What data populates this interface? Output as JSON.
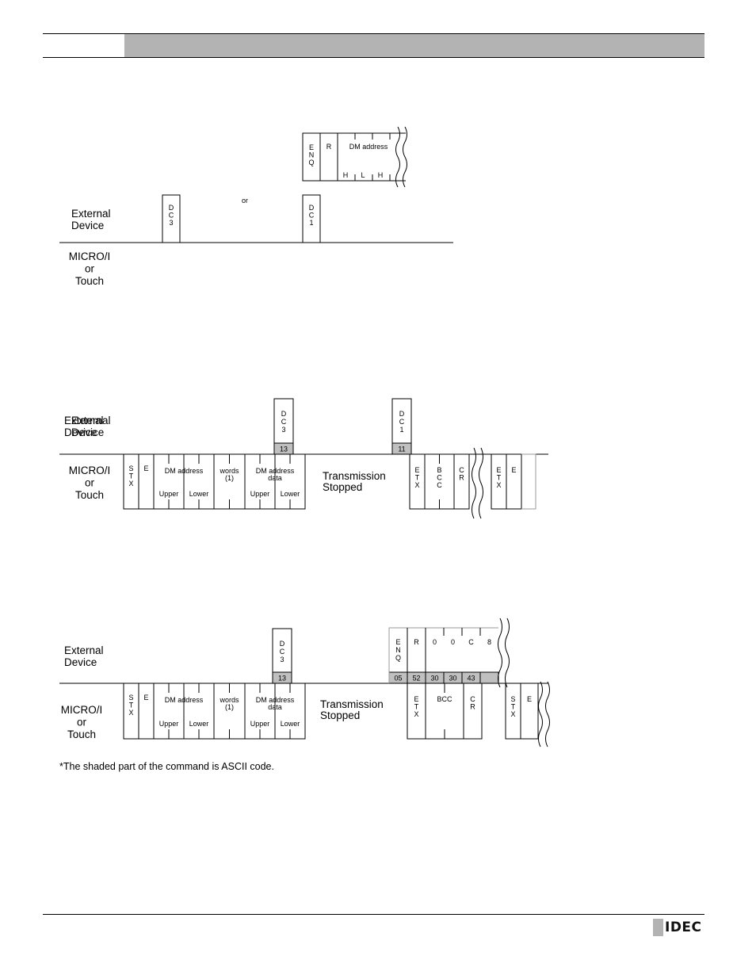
{
  "header": {
    "title": ""
  },
  "diagrams": [
    {
      "id": "flow-control-1",
      "external_label": [
        "External",
        "Device"
      ],
      "micro_label": [
        "MICRO/I",
        "or",
        "Touch"
      ],
      "separator_word": "or",
      "command_frame": {
        "fields": [
          {
            "label": [
              "E",
              "N",
              "Q"
            ],
            "vertical": true
          },
          {
            "label": [
              "R"
            ],
            "vertical": false
          },
          {
            "label": [
              "DM address"
            ],
            "sub": [
              "H",
              "L",
              "H"
            ]
          }
        ]
      },
      "external_boxes": [
        {
          "label": [
            "D",
            "C",
            "3"
          ],
          "ascii": ""
        },
        {
          "label": [
            "D",
            "C",
            "1"
          ],
          "ascii": ""
        }
      ]
    },
    {
      "id": "flow-control-2",
      "external_label": [
        "External",
        "Device"
      ],
      "micro_label": [
        "MICRO/I",
        "or",
        "Touch"
      ],
      "external_boxes": [
        {
          "label": [
            "D",
            "C",
            "3"
          ],
          "ascii": "13"
        },
        {
          "label": [
            "D",
            "C",
            "1"
          ],
          "ascii": "11"
        }
      ],
      "response_fields": [
        {
          "label": [
            "S",
            "T",
            "X"
          ]
        },
        {
          "label": [
            "E"
          ]
        },
        {
          "label": [
            "DM address"
          ],
          "sub": [
            "Upper",
            "Lower"
          ]
        },
        {
          "label": [
            "words",
            "(1)"
          ]
        },
        {
          "label": [
            "DM address",
            "data"
          ],
          "sub": [
            "Upper",
            "Lower"
          ]
        }
      ],
      "stopped_label": [
        "Transmission",
        "Stopped"
      ],
      "tail_fields": [
        {
          "label": [
            "E",
            "T",
            "X"
          ]
        },
        {
          "label": [
            "B",
            "C",
            "C"
          ]
        },
        {
          "label": [
            "C",
            "R"
          ]
        }
      ],
      "after_break_fields": [
        {
          "label": [
            "E",
            "T",
            "X"
          ]
        },
        {
          "label": [
            "E"
          ]
        },
        {
          "label": [
            ""
          ]
        }
      ]
    },
    {
      "id": "flow-control-3",
      "external_label": [
        "External",
        "Device"
      ],
      "micro_label": [
        "MICRO/I",
        "or",
        "Touch"
      ],
      "external_boxes": [
        {
          "label": [
            "D",
            "C",
            "3"
          ],
          "ascii": "13"
        }
      ],
      "command_frame": {
        "fields": [
          {
            "label": [
              "E",
              "N",
              "Q"
            ],
            "ascii": "05"
          },
          {
            "label": [
              "R"
            ],
            "ascii": "52"
          },
          {
            "label": [
              "0"
            ],
            "ascii": "30"
          },
          {
            "label": [
              "0"
            ],
            "ascii": "30"
          },
          {
            "label": [
              "C"
            ],
            "ascii": "43"
          },
          {
            "label": [
              "8"
            ],
            "ascii": ""
          }
        ]
      },
      "response_fields": [
        {
          "label": [
            "S",
            "T",
            "X"
          ]
        },
        {
          "label": [
            "E"
          ]
        },
        {
          "label": [
            "DM address"
          ],
          "sub": [
            "Upper",
            "Lower"
          ]
        },
        {
          "label": [
            "words",
            "(1)"
          ]
        },
        {
          "label": [
            "DM address",
            "data"
          ],
          "sub": [
            "Upper",
            "Lower"
          ]
        }
      ],
      "stopped_label": [
        "Transmission",
        "Stopped"
      ],
      "tail_fields": [
        {
          "label": [
            "E",
            "T",
            "X"
          ]
        },
        {
          "label": [
            "BCC"
          ]
        },
        {
          "label": [
            "C",
            "R"
          ]
        }
      ],
      "after_break_fields": [
        {
          "label": [
            "S",
            "T",
            "X"
          ]
        },
        {
          "label": [
            "E"
          ]
        }
      ]
    }
  ],
  "footnote": "*The shaded part of the command is ASCII code.",
  "footer": {
    "logo": "IDEC"
  },
  "colors": {
    "shade": "#c0c0c0",
    "header_band": "#b3b3b3"
  }
}
